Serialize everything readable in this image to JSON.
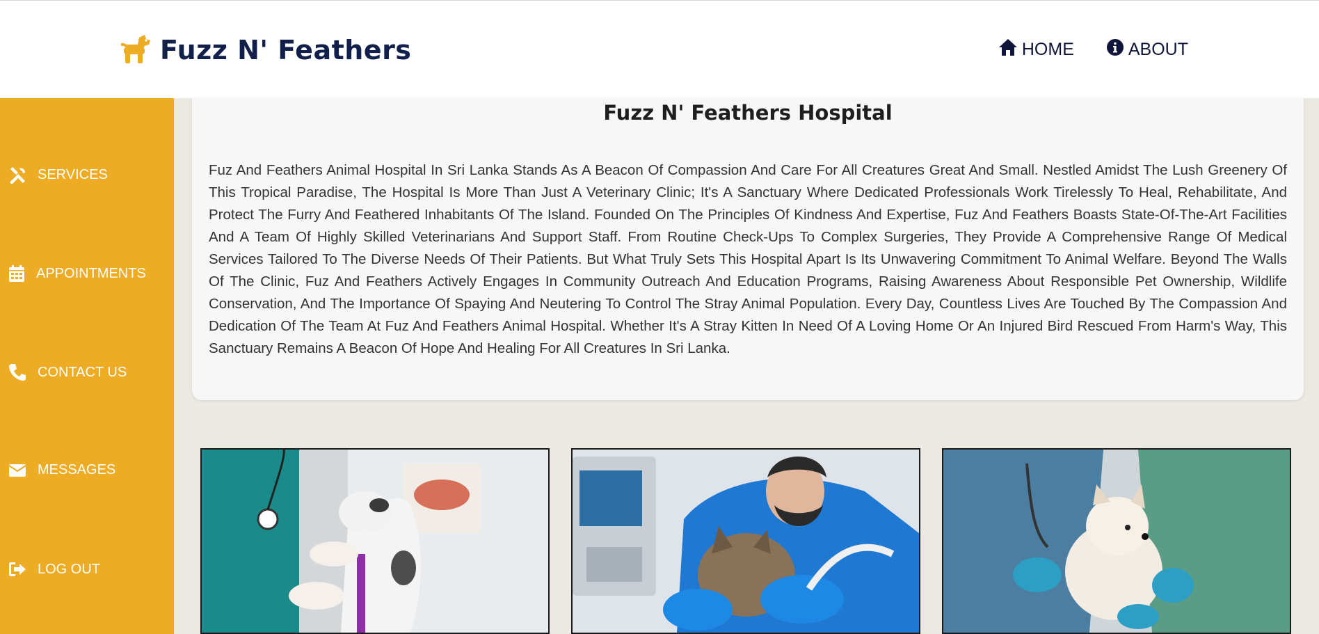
{
  "header": {
    "brand": "Fuzz N' Feathers",
    "logo_icon": "dog-icon",
    "nav": [
      {
        "label": "HOME",
        "icon": "home-icon"
      },
      {
        "label": "ABOUT",
        "icon": "info-circle-icon"
      }
    ]
  },
  "sidebar": {
    "items": [
      {
        "label": "SERVICES",
        "icon": "tools-icon"
      },
      {
        "label": "APPOINTMENTS",
        "icon": "calendar-icon"
      },
      {
        "label": "CONTACT US",
        "icon": "phone-icon"
      },
      {
        "label": "MESSAGES",
        "icon": "envelope-icon"
      },
      {
        "label": "LOG OUT",
        "icon": "sign-out-icon"
      }
    ]
  },
  "main": {
    "title": "Fuzz N' Feathers Hospital",
    "body": "Fuz And Feathers Animal Hospital In Sri Lanka Stands As A Beacon Of Compassion And Care For All Creatures Great And Small. Nestled Amidst The Lush Greenery Of This Tropical Paradise, The Hospital Is More Than Just A Veterinary Clinic; It's A Sanctuary Where Dedicated Professionals Work Tirelessly To Heal, Rehabilitate, And Protect The Furry And Feathered Inhabitants Of The Island. Founded On The Principles Of Kindness And Expertise, Fuz And Feathers Boasts State-Of-The-Art Facilities And A Team Of Highly Skilled Veterinarians And Support Staff. From Routine Check-Ups To Complex Surgeries, They Provide A Comprehensive Range Of Medical Services Tailored To The Diverse Needs Of Their Patients. But What Truly Sets This Hospital Apart Is Its Unwavering Commitment To Animal Welfare. Beyond The Walls Of The Clinic, Fuz And Feathers Actively Engages In Community Outreach And Education Programs, Raising Awareness About Responsible Pet Ownership, Wildlife Conservation, And The Importance Of Spaying And Neutering To Control The Stray Animal Population. Every Day, Countless Lives Are Touched By The Compassion And Dedication Of The Team At Fuz And Feathers Animal Hospital. Whether It's A Stray Kitten In Need Of A Loving Home Or An Injured Bird Rescued From Harm's Way, This Sanctuary Remains A Beacon Of Hope And Healing For All Creatures In Sri Lanka."
  },
  "colors": {
    "sidebar": "#eeab24",
    "brand_text": "#10204a",
    "page_bg": "#ece8e2",
    "card_bg": "#f7f7f7"
  }
}
